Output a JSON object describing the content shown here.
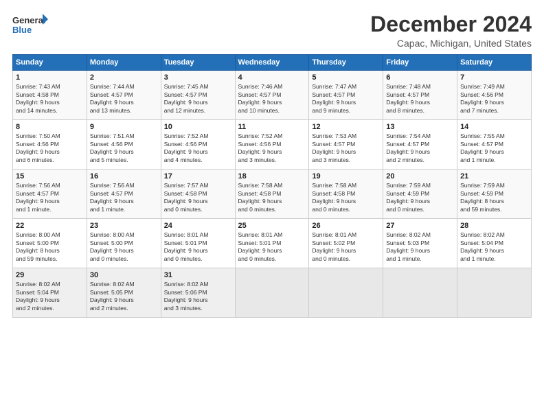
{
  "logo": {
    "line1": "General",
    "line2": "Blue"
  },
  "title": "December 2024",
  "subtitle": "Capac, Michigan, United States",
  "days_of_week": [
    "Sunday",
    "Monday",
    "Tuesday",
    "Wednesday",
    "Thursday",
    "Friday",
    "Saturday"
  ],
  "weeks": [
    [
      {
        "day": "1",
        "info": "Sunrise: 7:43 AM\nSunset: 4:58 PM\nDaylight: 9 hours\nand 14 minutes."
      },
      {
        "day": "2",
        "info": "Sunrise: 7:44 AM\nSunset: 4:57 PM\nDaylight: 9 hours\nand 13 minutes."
      },
      {
        "day": "3",
        "info": "Sunrise: 7:45 AM\nSunset: 4:57 PM\nDaylight: 9 hours\nand 12 minutes."
      },
      {
        "day": "4",
        "info": "Sunrise: 7:46 AM\nSunset: 4:57 PM\nDaylight: 9 hours\nand 10 minutes."
      },
      {
        "day": "5",
        "info": "Sunrise: 7:47 AM\nSunset: 4:57 PM\nDaylight: 9 hours\nand 9 minutes."
      },
      {
        "day": "6",
        "info": "Sunrise: 7:48 AM\nSunset: 4:57 PM\nDaylight: 9 hours\nand 8 minutes."
      },
      {
        "day": "7",
        "info": "Sunrise: 7:49 AM\nSunset: 4:56 PM\nDaylight: 9 hours\nand 7 minutes."
      }
    ],
    [
      {
        "day": "8",
        "info": "Sunrise: 7:50 AM\nSunset: 4:56 PM\nDaylight: 9 hours\nand 6 minutes."
      },
      {
        "day": "9",
        "info": "Sunrise: 7:51 AM\nSunset: 4:56 PM\nDaylight: 9 hours\nand 5 minutes."
      },
      {
        "day": "10",
        "info": "Sunrise: 7:52 AM\nSunset: 4:56 PM\nDaylight: 9 hours\nand 4 minutes."
      },
      {
        "day": "11",
        "info": "Sunrise: 7:52 AM\nSunset: 4:56 PM\nDaylight: 9 hours\nand 3 minutes."
      },
      {
        "day": "12",
        "info": "Sunrise: 7:53 AM\nSunset: 4:57 PM\nDaylight: 9 hours\nand 3 minutes."
      },
      {
        "day": "13",
        "info": "Sunrise: 7:54 AM\nSunset: 4:57 PM\nDaylight: 9 hours\nand 2 minutes."
      },
      {
        "day": "14",
        "info": "Sunrise: 7:55 AM\nSunset: 4:57 PM\nDaylight: 9 hours\nand 1 minute."
      }
    ],
    [
      {
        "day": "15",
        "info": "Sunrise: 7:56 AM\nSunset: 4:57 PM\nDaylight: 9 hours\nand 1 minute."
      },
      {
        "day": "16",
        "info": "Sunrise: 7:56 AM\nSunset: 4:57 PM\nDaylight: 9 hours\nand 1 minute."
      },
      {
        "day": "17",
        "info": "Sunrise: 7:57 AM\nSunset: 4:58 PM\nDaylight: 9 hours\nand 0 minutes."
      },
      {
        "day": "18",
        "info": "Sunrise: 7:58 AM\nSunset: 4:58 PM\nDaylight: 9 hours\nand 0 minutes."
      },
      {
        "day": "19",
        "info": "Sunrise: 7:58 AM\nSunset: 4:58 PM\nDaylight: 9 hours\nand 0 minutes."
      },
      {
        "day": "20",
        "info": "Sunrise: 7:59 AM\nSunset: 4:59 PM\nDaylight: 9 hours\nand 0 minutes."
      },
      {
        "day": "21",
        "info": "Sunrise: 7:59 AM\nSunset: 4:59 PM\nDaylight: 8 hours\nand 59 minutes."
      }
    ],
    [
      {
        "day": "22",
        "info": "Sunrise: 8:00 AM\nSunset: 5:00 PM\nDaylight: 8 hours\nand 59 minutes."
      },
      {
        "day": "23",
        "info": "Sunrise: 8:00 AM\nSunset: 5:00 PM\nDaylight: 9 hours\nand 0 minutes."
      },
      {
        "day": "24",
        "info": "Sunrise: 8:01 AM\nSunset: 5:01 PM\nDaylight: 9 hours\nand 0 minutes."
      },
      {
        "day": "25",
        "info": "Sunrise: 8:01 AM\nSunset: 5:01 PM\nDaylight: 9 hours\nand 0 minutes."
      },
      {
        "day": "26",
        "info": "Sunrise: 8:01 AM\nSunset: 5:02 PM\nDaylight: 9 hours\nand 0 minutes."
      },
      {
        "day": "27",
        "info": "Sunrise: 8:02 AM\nSunset: 5:03 PM\nDaylight: 9 hours\nand 1 minute."
      },
      {
        "day": "28",
        "info": "Sunrise: 8:02 AM\nSunset: 5:04 PM\nDaylight: 9 hours\nand 1 minute."
      }
    ],
    [
      {
        "day": "29",
        "info": "Sunrise: 8:02 AM\nSunset: 5:04 PM\nDaylight: 9 hours\nand 2 minutes."
      },
      {
        "day": "30",
        "info": "Sunrise: 8:02 AM\nSunset: 5:05 PM\nDaylight: 9 hours\nand 2 minutes."
      },
      {
        "day": "31",
        "info": "Sunrise: 8:02 AM\nSunset: 5:06 PM\nDaylight: 9 hours\nand 3 minutes."
      },
      {
        "day": "",
        "info": ""
      },
      {
        "day": "",
        "info": ""
      },
      {
        "day": "",
        "info": ""
      },
      {
        "day": "",
        "info": ""
      }
    ]
  ]
}
